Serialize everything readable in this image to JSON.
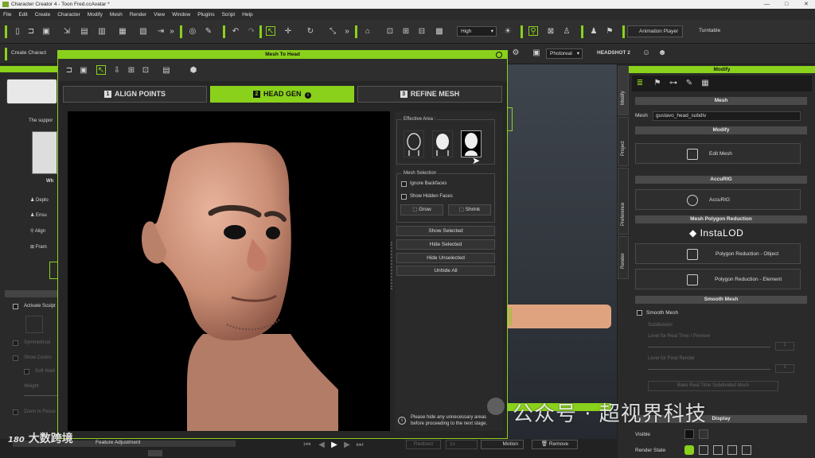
{
  "window": {
    "title": "Character Creator 4 - Toon Fred.ccAvatar *",
    "minimize": "—",
    "maximize": "□",
    "close": "✕"
  },
  "menu": [
    "File",
    "Edit",
    "Create",
    "Character",
    "Modify",
    "Mesh",
    "Render",
    "View",
    "Window",
    "Plugins",
    "Script",
    "Help"
  ],
  "toolbar": {
    "quality": "High",
    "animation_player": "Animation Player",
    "turntable": "Turntable",
    "render_mode": "Photoreal",
    "headshot": "HEADSHOT 2",
    "create_char": "Create Charact"
  },
  "left_panel": {
    "support_text": "The suppor",
    "who": "Wh",
    "items": [
      "Deplo",
      "Ensu",
      "Align",
      "Fram"
    ],
    "activate_sculpt": "Activate Sculpt",
    "symmetrical": "Symmetrical",
    "show_control": "Show Contro",
    "soft_hold": "Soft Hold",
    "weight": "Weight",
    "zoom_in_focus": "Zoom in Focus"
  },
  "dialog": {
    "title": "Mesh To Head",
    "steps": [
      {
        "num": "1",
        "label": "ALIGN POINTS"
      },
      {
        "num": "2",
        "label": "HEAD GEN",
        "badge": "i"
      },
      {
        "num": "3",
        "label": "REFINE MESH"
      }
    ],
    "effective_area": "Effective Area :",
    "mesh_selection": "Mesh Selection",
    "ignore_backfaces": "Ignore Backfaces",
    "show_hidden_faces": "Show Hidden Faces",
    "grow": "Grow",
    "shrink": "Shrink",
    "show_selected": "Show Selected",
    "hide_selected": "Hide Selected",
    "hide_unselected": "Hide Unselected",
    "unhide_all": "Unhide All",
    "hint": "Please hide any unnecessary areas before proceeding to the next stage."
  },
  "vtabs": [
    "Modify",
    "Project",
    "Preference",
    "Render"
  ],
  "modify_panel": {
    "title": "Modify",
    "mesh_header": "Mesh",
    "mesh_label": "Mesh",
    "mesh_value": "gustavo_head_subdiv",
    "modify_header": "Modify",
    "edit_mesh": "Edit Mesh",
    "accurig_header": "AccuRIG",
    "accurig_btn": "AccuRIG",
    "reduction_header": "Mesh Polygon Reduction",
    "instalod": "InstaLOD",
    "poly_object": "Polygon Reduction - Object",
    "poly_element": "Polygon Reduction - Element",
    "smooth_header": "Smooth Mesh",
    "smooth_mesh": "Smooth Mesh",
    "subdivision": "Subdivision",
    "level_realtime": "Level for Real Time / Preview",
    "level_final": "Level for Final Render",
    "level_val_1": "1",
    "level_val_2": "1",
    "bake": "Bake Real Time Subdivided Mesh",
    "display_header": "Display",
    "visible": "Visible",
    "render_state": "Render State"
  },
  "bottom": {
    "feature_adjustment": "Feature Adjustment",
    "redirect": "Redirect",
    "fps": "1x",
    "motion": "Motion",
    "remove": "Remove"
  },
  "watermarks": {
    "left": "大数跨境",
    "left_logo": "180",
    "right": "公众号 · 超视界科技"
  },
  "colors": {
    "accent": "#8ad11c",
    "panel": "#2a2a2a",
    "skin": "#d9a088"
  }
}
